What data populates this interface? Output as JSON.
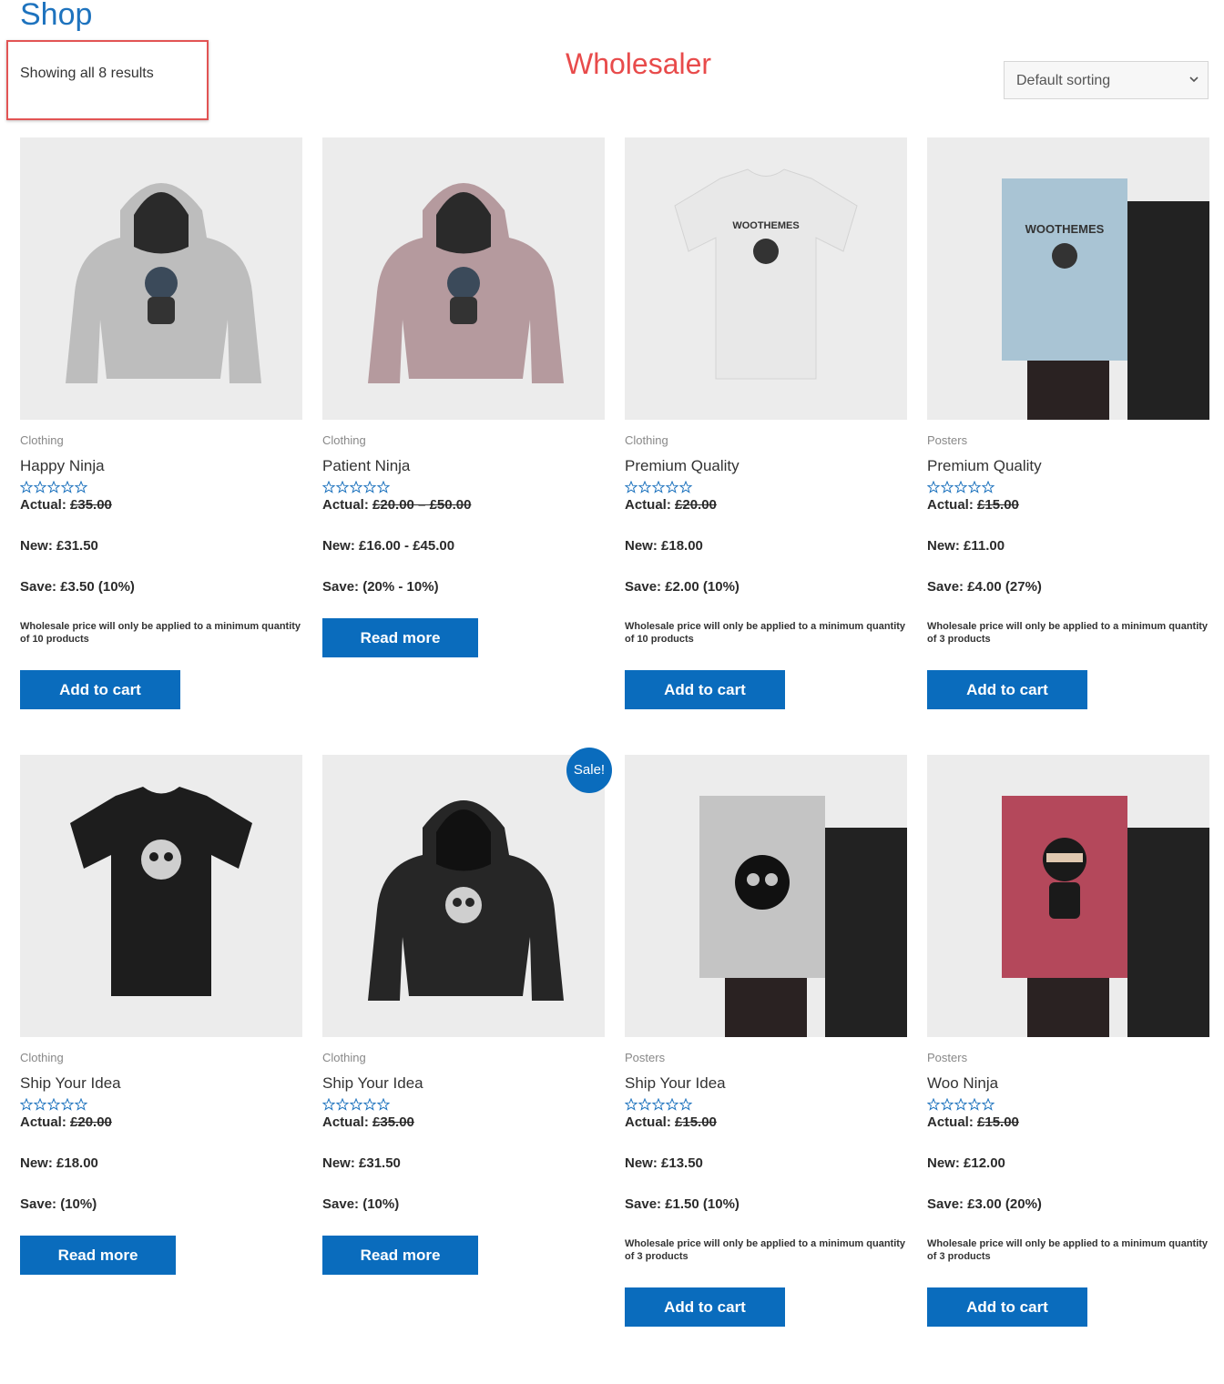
{
  "page": {
    "title": "Shop",
    "result_count": "Showing all 8 results",
    "annotation": "Wholesaler",
    "sorting": "Default sorting"
  },
  "colors": {
    "brand": "#0a6cbd",
    "annotation": "#e84b4b",
    "link": "#1e73be"
  },
  "products": [
    {
      "category": "Clothing",
      "name": "Happy Ninja",
      "actual_label": "Actual: ",
      "actual_price": "£35.00",
      "new": "New: £31.50",
      "save": "Save: £3.50 (10%)",
      "note": "Wholesale price will only be applied to a minimum quantity of 10 products",
      "button": "Add to cart",
      "sale": "",
      "image": "grey-hoodie-ninja"
    },
    {
      "category": "Clothing",
      "name": "Patient Ninja",
      "actual_label": "Actual: ",
      "actual_price": "£20.00 – £50.00",
      "new": "New: £16.00 - £45.00",
      "save": "Save: (20% - 10%)",
      "note": "",
      "button": "Read more",
      "sale": "",
      "image": "pink-hoodie-ninja"
    },
    {
      "category": "Clothing",
      "name": "Premium Quality",
      "actual_label": "Actual: ",
      "actual_price": "£20.00",
      "new": "New: £18.00",
      "save": "Save: £2.00 (10%)",
      "note": "Wholesale price will only be applied to a minimum quantity of 10 products",
      "button": "Add to cart",
      "sale": "",
      "image": "white-tshirt-woothemes"
    },
    {
      "category": "Posters",
      "name": "Premium Quality",
      "actual_label": "Actual: ",
      "actual_price": "£15.00",
      "new": "New: £11.00",
      "save": "Save: £4.00 (27%)",
      "note": "Wholesale price will only be applied to a minimum quantity of 3 products",
      "button": "Add to cart",
      "sale": "",
      "image": "blue-poster-woothemes"
    },
    {
      "category": "Clothing",
      "name": "Ship Your Idea",
      "actual_label": "Actual: ",
      "actual_price": "£20.00",
      "new": "New: £18.00",
      "save": "Save: (10%)",
      "note": "",
      "button": "Read more",
      "sale": "",
      "image": "black-tshirt-skull"
    },
    {
      "category": "Clothing",
      "name": "Ship Your Idea",
      "actual_label": "Actual: ",
      "actual_price": "£35.00",
      "new": "New: £31.50",
      "save": "Save: (10%)",
      "note": "",
      "button": "Read more",
      "sale": "Sale!",
      "image": "black-hoodie-skull"
    },
    {
      "category": "Posters",
      "name": "Ship Your Idea",
      "actual_label": "Actual: ",
      "actual_price": "£15.00",
      "new": "New: £13.50",
      "save": "Save: £1.50 (10%)",
      "note": "Wholesale price will only be applied to a minimum quantity of 3 products",
      "button": "Add to cart",
      "sale": "",
      "image": "grey-poster-skull"
    },
    {
      "category": "Posters",
      "name": "Woo Ninja",
      "actual_label": "Actual: ",
      "actual_price": "£15.00",
      "new": "New: £12.00",
      "save": "Save: £3.00 (20%)",
      "note": "Wholesale price will only be applied to a minimum quantity of 3 products",
      "button": "Add to cart",
      "sale": "",
      "image": "red-poster-ninja"
    }
  ]
}
